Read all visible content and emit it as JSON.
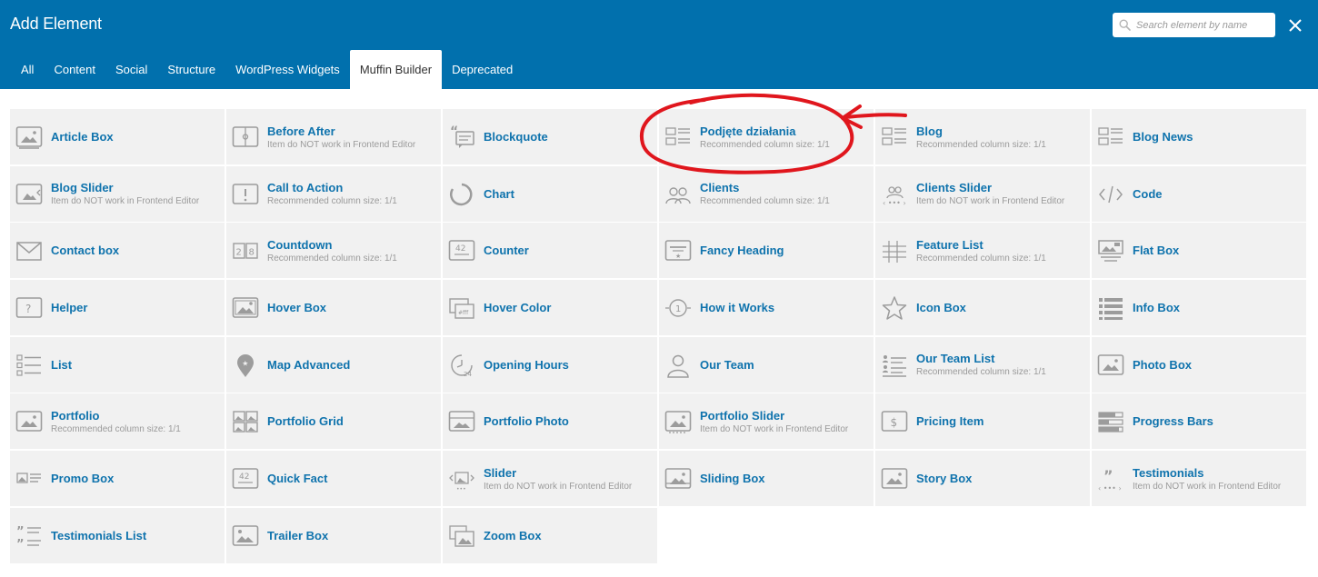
{
  "app": {
    "title": "Add Element",
    "search_placeholder": "Search element by name"
  },
  "tabs": [
    {
      "label": "All",
      "active": false
    },
    {
      "label": "Content",
      "active": false
    },
    {
      "label": "Social",
      "active": false
    },
    {
      "label": "Structure",
      "active": false
    },
    {
      "label": "WordPress Widgets",
      "active": false
    },
    {
      "label": "Muffin Builder",
      "active": true
    },
    {
      "label": "Deprecated",
      "active": false
    }
  ],
  "elements": [
    {
      "label": "Article Box",
      "note": "",
      "icon": "article-box-icon"
    },
    {
      "label": "Before After",
      "note": "Item do NOT work in Frontend Editor",
      "icon": "before-after-icon"
    },
    {
      "label": "Blockquote",
      "note": "",
      "icon": "blockquote-icon"
    },
    {
      "label": "Podjęte działania",
      "note": "Recommended column size: 1/1",
      "icon": "blog-icon"
    },
    {
      "label": "Blog",
      "note": "Recommended column size: 1/1",
      "icon": "blog-icon"
    },
    {
      "label": "Blog News",
      "note": "",
      "icon": "blog-news-icon"
    },
    {
      "label": "Blog Slider",
      "note": "Item do NOT work in Frontend Editor",
      "icon": "blog-slider-icon"
    },
    {
      "label": "Call to Action",
      "note": "Recommended column size: 1/1",
      "icon": "call-to-action-icon"
    },
    {
      "label": "Chart",
      "note": "",
      "icon": "chart-icon"
    },
    {
      "label": "Clients",
      "note": "Recommended column size: 1/1",
      "icon": "clients-icon"
    },
    {
      "label": "Clients Slider",
      "note": "Item do NOT work in Frontend Editor",
      "icon": "clients-slider-icon"
    },
    {
      "label": "Code",
      "note": "",
      "icon": "code-icon"
    },
    {
      "label": "Contact box",
      "note": "",
      "icon": "contact-box-icon"
    },
    {
      "label": "Countdown",
      "note": "Recommended column size: 1/1",
      "icon": "countdown-icon"
    },
    {
      "label": "Counter",
      "note": "",
      "icon": "counter-icon"
    },
    {
      "label": "Fancy Heading",
      "note": "",
      "icon": "fancy-heading-icon"
    },
    {
      "label": "Feature List",
      "note": "Recommended column size: 1/1",
      "icon": "feature-list-icon"
    },
    {
      "label": "Flat Box",
      "note": "",
      "icon": "flat-box-icon"
    },
    {
      "label": "Helper",
      "note": "",
      "icon": "helper-icon"
    },
    {
      "label": "Hover Box",
      "note": "",
      "icon": "hover-box-icon"
    },
    {
      "label": "Hover Color",
      "note": "",
      "icon": "hover-color-icon"
    },
    {
      "label": "How it Works",
      "note": "",
      "icon": "how-it-works-icon"
    },
    {
      "label": "Icon Box",
      "note": "",
      "icon": "star-icon"
    },
    {
      "label": "Info Box",
      "note": "",
      "icon": "info-box-icon"
    },
    {
      "label": "List",
      "note": "",
      "icon": "list-icon"
    },
    {
      "label": "Map Advanced",
      "note": "",
      "icon": "map-pin-icon"
    },
    {
      "label": "Opening Hours",
      "note": "",
      "icon": "clock-icon"
    },
    {
      "label": "Our Team",
      "note": "",
      "icon": "person-icon"
    },
    {
      "label": "Our Team List",
      "note": "Recommended column size: 1/1",
      "icon": "team-list-icon"
    },
    {
      "label": "Photo Box",
      "note": "",
      "icon": "photo-box-icon"
    },
    {
      "label": "Portfolio",
      "note": "Recommended column size: 1/1",
      "icon": "portfolio-icon"
    },
    {
      "label": "Portfolio Grid",
      "note": "",
      "icon": "portfolio-grid-icon"
    },
    {
      "label": "Portfolio Photo",
      "note": "",
      "icon": "portfolio-photo-icon"
    },
    {
      "label": "Portfolio Slider",
      "note": "Item do NOT work in Frontend Editor",
      "icon": "portfolio-slider-icon"
    },
    {
      "label": "Pricing Item",
      "note": "",
      "icon": "dollar-icon"
    },
    {
      "label": "Progress Bars",
      "note": "",
      "icon": "progress-bars-icon"
    },
    {
      "label": "Promo Box",
      "note": "",
      "icon": "promo-box-icon"
    },
    {
      "label": "Quick Fact",
      "note": "",
      "icon": "quick-fact-icon"
    },
    {
      "label": "Slider",
      "note": "Item do NOT work in Frontend Editor",
      "icon": "slider-icon"
    },
    {
      "label": "Sliding Box",
      "note": "",
      "icon": "sliding-box-icon"
    },
    {
      "label": "Story Box",
      "note": "",
      "icon": "story-box-icon"
    },
    {
      "label": "Testimonials",
      "note": "Item do NOT work in Frontend Editor",
      "icon": "testimonials-icon"
    },
    {
      "label": "Testimonials List",
      "note": "",
      "icon": "testimonials-list-icon"
    },
    {
      "label": "Trailer Box",
      "note": "",
      "icon": "trailer-box-icon"
    },
    {
      "label": "Zoom Box",
      "note": "",
      "icon": "zoom-box-icon"
    }
  ],
  "colors": {
    "header": "#0170ad",
    "label": "#0f73ad",
    "note": "#9a9a9a",
    "tile": "#f1f1f1",
    "annotation": "#e0161d"
  }
}
